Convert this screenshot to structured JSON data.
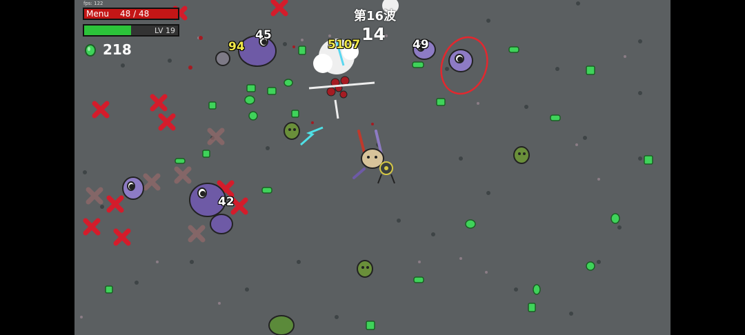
{
  "hud": {
    "fps_label": "fps: 122",
    "menu_label": "Menu",
    "hp_text": "48 / 48",
    "hp_fraction": 1.0,
    "level_text": "LV 19",
    "xp_fraction": 0.5,
    "materials_count": "218",
    "wave_label": "第16波",
    "timer": "14"
  },
  "damage_numbers": [
    {
      "id": "dmg-94",
      "text": "94",
      "crit": true
    },
    {
      "id": "dmg-45",
      "text": "45",
      "crit": false
    },
    {
      "id": "dmg-5107",
      "text": "5107",
      "crit": true
    },
    {
      "id": "dmg-49",
      "text": "49",
      "crit": false
    },
    {
      "id": "dmg-42",
      "text": "42",
      "crit": false
    }
  ],
  "colors": {
    "ground": "#5b5f61",
    "health": "#c41616",
    "experience": "#2cc43a",
    "enemy": "#6e5aa6",
    "material": "#3fd35a",
    "death_mark": "#d41c2b",
    "crit_text": "#f1e84a"
  },
  "icons": {
    "materials": "green-fruit-icon"
  }
}
